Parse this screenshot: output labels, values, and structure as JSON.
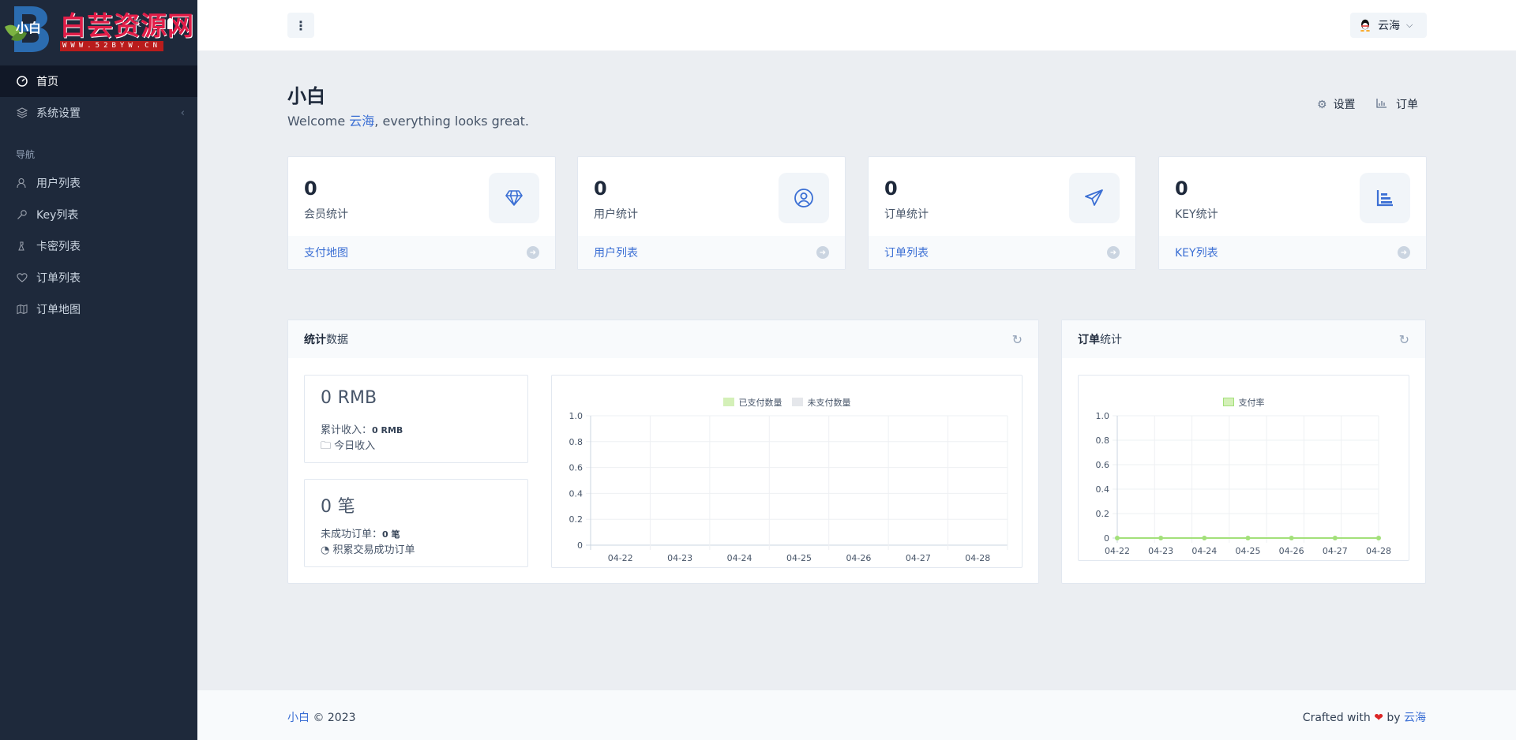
{
  "sidebar": {
    "logo_text": "白芸资源网",
    "logo_sub": "WWW.52BYW.CN",
    "brand_title": "小白",
    "items": [
      {
        "label": "首页"
      },
      {
        "label": "系统设置"
      },
      {
        "label": "用户列表"
      },
      {
        "label": "Key列表"
      },
      {
        "label": "卡密列表"
      },
      {
        "label": "订单列表"
      },
      {
        "label": "订单地图"
      }
    ],
    "heading": "导航"
  },
  "header": {
    "menu_label": "⋮",
    "user_name": "云海"
  },
  "hero": {
    "title": "小白",
    "welcome_prefix": "Welcome ",
    "welcome_user": "云海",
    "welcome_suffix": ", everything looks great.",
    "action_settings": "设置",
    "action_orders": "订单"
  },
  "stats": [
    {
      "value": "0",
      "label": "会员统计",
      "link": "支付地图",
      "icon": "diamond-icon"
    },
    {
      "value": "0",
      "label": "用户统计",
      "link": "用户列表",
      "icon": "user-circle-icon"
    },
    {
      "value": "0",
      "label": "订单统计",
      "link": "订单列表",
      "icon": "paper-plane-icon"
    },
    {
      "value": "0",
      "label": "KEY统计",
      "link": "KEY列表",
      "icon": "bar-chart-icon"
    }
  ],
  "panel_stats": {
    "title_bold": "统计",
    "title_rest": "数据",
    "revenue": {
      "value": "0",
      "unit": "RMB",
      "label": "累计收入：",
      "label_value": "0 RMB",
      "sub": "今日收入"
    },
    "orders": {
      "value": "0",
      "unit": "笔",
      "label": "未成功订单：",
      "label_value": "0 笔",
      "sub": "积累交易成功订单"
    }
  },
  "panel_orders": {
    "title_bold": "订单",
    "title_rest": "统计"
  },
  "chart_data": [
    {
      "type": "bar",
      "categories": [
        "04-22",
        "04-23",
        "04-24",
        "04-25",
        "04-26",
        "04-27",
        "04-28"
      ],
      "series": [
        {
          "name": "已支付数量",
          "values": [
            0,
            0,
            0,
            0,
            0,
            0,
            0
          ],
          "color": "#d4f0b8"
        },
        {
          "name": "未支付数量",
          "values": [
            0,
            0,
            0,
            0,
            0,
            0,
            0
          ],
          "color": "#e5e7eb"
        }
      ],
      "yticks": [
        "0",
        "0.2",
        "0.4",
        "0.6",
        "0.8",
        "1.0"
      ],
      "ylim": [
        0,
        1
      ],
      "grid": true,
      "legend": "top"
    },
    {
      "type": "line",
      "categories": [
        "04-22",
        "04-23",
        "04-24",
        "04-25",
        "04-26",
        "04-27",
        "04-28"
      ],
      "series": [
        {
          "name": "支付率",
          "values": [
            0,
            0,
            0,
            0,
            0,
            0,
            0
          ],
          "color": "#a3e07a"
        }
      ],
      "yticks": [
        "0",
        "0.2",
        "0.4",
        "0.6",
        "0.8",
        "1.0"
      ],
      "ylim": [
        0,
        1
      ],
      "grid": true,
      "legend": "top"
    }
  ],
  "footer": {
    "brand": "小白",
    "copyright": " © 2023",
    "crafted": "Crafted with ",
    "heart": "❤",
    "by": " by ",
    "author": "云海"
  },
  "colors": {
    "sidebar_bg": "#1e293b",
    "accent": "#3b6fd4",
    "heart": "#dc2626"
  }
}
